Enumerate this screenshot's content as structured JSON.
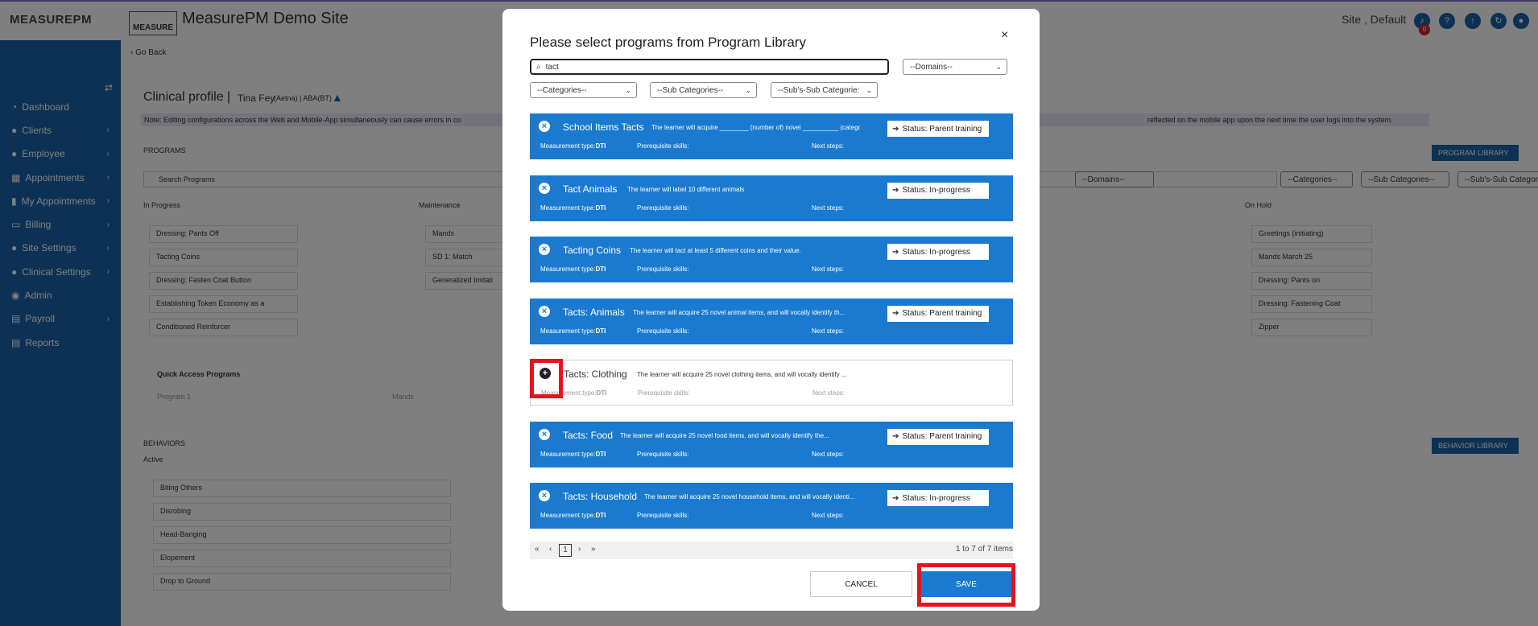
{
  "header": {
    "logo": "MEASUREPM",
    "logo2": "MEASURE",
    "site_title": "MeasurePM Demo Site",
    "site_info": "Site , Default",
    "badge": "0"
  },
  "sidebar": {
    "items": [
      {
        "label": "Dashboard",
        "icon": "◔",
        "chev": ""
      },
      {
        "label": "Clients",
        "icon": "●",
        "chev": "›"
      },
      {
        "label": "Employee",
        "icon": "●",
        "chev": "›"
      },
      {
        "label": "Appointments",
        "icon": "▦",
        "chev": "›"
      },
      {
        "label": "My Appointments",
        "icon": "▮",
        "chev": "›"
      },
      {
        "label": "Billing",
        "icon": "▭",
        "chev": "›"
      },
      {
        "label": "Site Settings",
        "icon": "●",
        "chev": "›"
      },
      {
        "label": "Clinical Settings",
        "icon": "●",
        "chev": "›"
      },
      {
        "label": "Admin",
        "icon": "◉",
        "chev": ""
      },
      {
        "label": "Payroll",
        "icon": "▤",
        "chev": "›"
      },
      {
        "label": "Reports",
        "icon": "▤",
        "chev": ""
      }
    ]
  },
  "background": {
    "back": "‹ Go Back",
    "page_title": "Clinical profile |",
    "client": "Tina Fey",
    "client_meta": "(Aetna) | ABA(BT)",
    "note": "Note: Editing configurations across the Web and Mobile-App simultaneously can cause errors in co",
    "note_tail": "reflected on the mobile app upon the next time the user logs into the system.",
    "programs_heading": "PROGRAMS",
    "search_programs": "Search Programs",
    "program_library_btn": "PROGRAM LIBRARY",
    "filters": [
      "--Domains--",
      "--Categories--",
      "--Sub Categories--",
      "--Sub's-Sub Categorie"
    ],
    "col_in_progress": "In Progress",
    "col_maintenance": "Maintenance",
    "col_on_hold": "On Hold",
    "in_progress_items": [
      "Dressing: Pants Off",
      "Tacting Coins",
      "Dressing: Fasten Coat Button",
      "Establishing Token Economy as a",
      "Conditioned Reinforcer"
    ],
    "maintenance_items": [
      "Mands",
      "SD 1: Match",
      "Generalized Imitati"
    ],
    "on_hold_items": [
      "Greetings (initiating)",
      "Mands March 25",
      "Dressing: Pants on",
      "Dressing: Fastening Coat",
      "Zipper"
    ],
    "quick_access": "Quick Access Programs",
    "program1": "Program 1",
    "mands": "Mands",
    "behaviors_heading": "BEHAVIORS",
    "behavior_library_btn": "BEHAVIOR LIBRARY",
    "active": "Active",
    "behavior_items": [
      "Biting Others",
      "Disrobing",
      "Head-Banging",
      "Elopement",
      "Drop to Ground"
    ]
  },
  "modal": {
    "title": "Please select programs from Program Library",
    "close": "×",
    "search_value": "tact",
    "domains": "--Domains--",
    "categories": "--Categories--",
    "sub_categories": "--Sub Categories--",
    "subsub_categories": "--Sub's-Sub Categorie:",
    "measurement_label": "Measurement type:",
    "prereq_label": "Prerequisite skills:",
    "next_label": "Next steps:",
    "programs": [
      {
        "name": "School Items Tacts",
        "desc": "The learner will acquire ________ (number of) novel __________ (category) ...",
        "measure": "DTI",
        "status": "Status: Parent training",
        "selected": true
      },
      {
        "name": "Tact Animals",
        "desc": "The learner will label 10 different animals",
        "measure": "DTI",
        "status": "Status: In-progress",
        "selected": true
      },
      {
        "name": "Tacting Coins",
        "desc": "The learner will tact at least 5 different coins and their value.",
        "measure": "DTI",
        "status": "Status: In-progress",
        "selected": true
      },
      {
        "name": "Tacts: Animals",
        "desc": "The learner will acquire 25 novel animal items, and will vocally identify th...",
        "measure": "DTI",
        "status": "Status: Parent training",
        "selected": true
      },
      {
        "name": "Tacts: Clothing",
        "desc": "The learner will acquire 25 novel clothing items, and will vocally identify ...",
        "measure": "DTI",
        "status": "",
        "selected": false
      },
      {
        "name": "Tacts: Food",
        "desc": "The learner will acquire 25 novel food items, and will vocally identify the...",
        "measure": "DTI",
        "status": "Status: Parent training",
        "selected": true
      },
      {
        "name": "Tacts: Household",
        "desc": "The learner will acquire 25 novel household items, and will vocally identi...",
        "measure": "DTI",
        "status": "Status: In-progress",
        "selected": true
      }
    ],
    "pager": {
      "first": "«",
      "prev": "‹",
      "current": "1",
      "next": "›",
      "last": "»",
      "count": "1 to 7 of 7 items"
    },
    "cancel": "CANCEL",
    "save": "SAVE"
  },
  "colors": {
    "sidebar": "#1862a8",
    "card": "#1a7ad0",
    "highlight": "#e2141e"
  }
}
